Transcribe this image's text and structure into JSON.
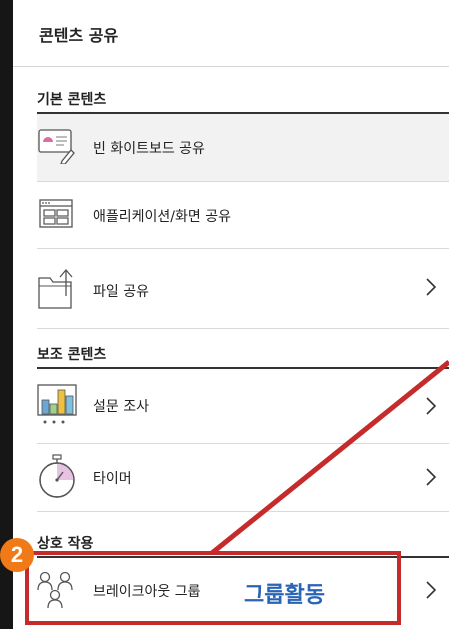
{
  "panel": {
    "title": "콘텐츠 공유",
    "sections": [
      {
        "label": "기본 콘텐츠",
        "items": [
          {
            "label": "빈 화이트보드 공유",
            "icon": "whiteboard-icon",
            "has_chevron": false
          },
          {
            "label": "애플리케이션/화면 공유",
            "icon": "screen-share-icon",
            "has_chevron": false
          },
          {
            "label": "파일 공유",
            "icon": "file-share-icon",
            "has_chevron": true
          }
        ]
      },
      {
        "label": "보조 콘텐츠",
        "items": [
          {
            "label": "설문 조사",
            "icon": "poll-icon",
            "has_chevron": true
          },
          {
            "label": "타이머",
            "icon": "timer-icon",
            "has_chevron": true
          }
        ]
      },
      {
        "label": "상호 작용",
        "items": [
          {
            "label": "브레이크아웃 그룹",
            "icon": "breakout-groups-icon",
            "has_chevron": true
          }
        ]
      }
    ]
  },
  "annotation": {
    "number": "2",
    "text": "그룹활동",
    "colors": {
      "box": "#c52b2b",
      "badge": "#f07a17",
      "text": "#2a64b5"
    }
  }
}
